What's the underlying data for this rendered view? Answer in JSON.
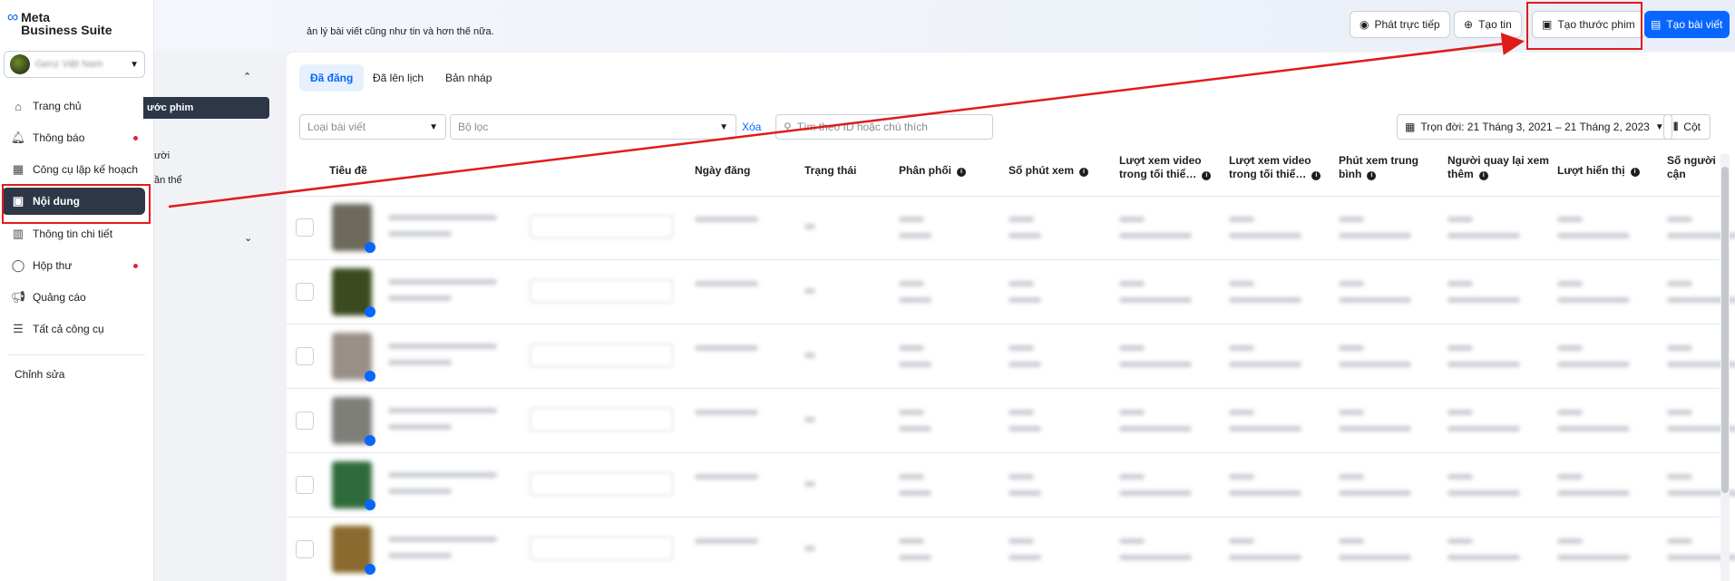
{
  "brand": {
    "name": "Meta\nBusiness Suite",
    "line1": "Meta",
    "line2": "Business Suite"
  },
  "account": {
    "name": "Genz Việt Nam"
  },
  "nav": {
    "items": [
      {
        "label": "Trang chủ",
        "icon": "home-icon"
      },
      {
        "label": "Thông báo",
        "icon": "bell-icon",
        "dot": true
      },
      {
        "label": "Công cụ lập kế hoạch",
        "icon": "calendar-icon"
      },
      {
        "label": "Nội dung",
        "icon": "content-icon",
        "active": true
      },
      {
        "label": "Thông tin chi tiết",
        "icon": "insights-icon"
      },
      {
        "label": "Hộp thư",
        "icon": "inbox-icon",
        "dot": true
      },
      {
        "label": "Quảng cáo",
        "icon": "megaphone-icon"
      },
      {
        "label": "Tất cả công cụ",
        "icon": "menu-icon"
      }
    ],
    "edit_label": "Chỉnh sửa"
  },
  "header": {
    "subtitle": "ản lý bài viết cũng như tin và hơn thế nữa.",
    "buttons": {
      "live": "Phát trực tiếp",
      "story": "Tạo tin",
      "reel": "Tạo thước phim",
      "post": "Tạo bài viết"
    }
  },
  "panel2": {
    "selected": "ước phim",
    "text1": "ười",
    "text2": "ần thể"
  },
  "tabs": [
    "Đã đăng",
    "Đã lên lịch",
    "Bản nháp"
  ],
  "filters": {
    "post_type": "Loại bài viết",
    "filter": "Bộ lọc",
    "clear": "Xóa",
    "search_placeholder": "Tìm theo ID hoặc chú thích",
    "date_range": "Trọn đời: 21 Tháng 3, 2021 – 21 Tháng 2, 2023",
    "columns": "Cột"
  },
  "table": {
    "headers": [
      {
        "label": "Tiêu đề",
        "info": false
      },
      {
        "label": "Ngày đăng",
        "info": false
      },
      {
        "label": "Trạng thái",
        "info": false
      },
      {
        "label": "Phân phối",
        "info": true
      },
      {
        "label": "Số phút xem",
        "info": true
      },
      {
        "label": "Lượt xem video trong tối thiể…",
        "info": true
      },
      {
        "label": "Lượt xem video trong tối thiể…",
        "info": true
      },
      {
        "label": "Phút xem trung bình",
        "info": true
      },
      {
        "label": "Người quay lại xem thêm",
        "info": true
      },
      {
        "label": "Lượt hiển thị",
        "info": true
      },
      {
        "label": "Số người cận",
        "info": false
      }
    ],
    "rows": [
      {
        "thumb": "#6d6a5c"
      },
      {
        "thumb": "#3b4a1f"
      },
      {
        "thumb": "#9a8f86"
      },
      {
        "thumb": "#7f7f7a"
      },
      {
        "thumb": "#2f6b3a"
      },
      {
        "thumb": "#8a6b2f"
      }
    ]
  },
  "colors": {
    "accent": "#0866ff",
    "active_nav": "#2d3748",
    "highlight": "#e01b1b"
  }
}
